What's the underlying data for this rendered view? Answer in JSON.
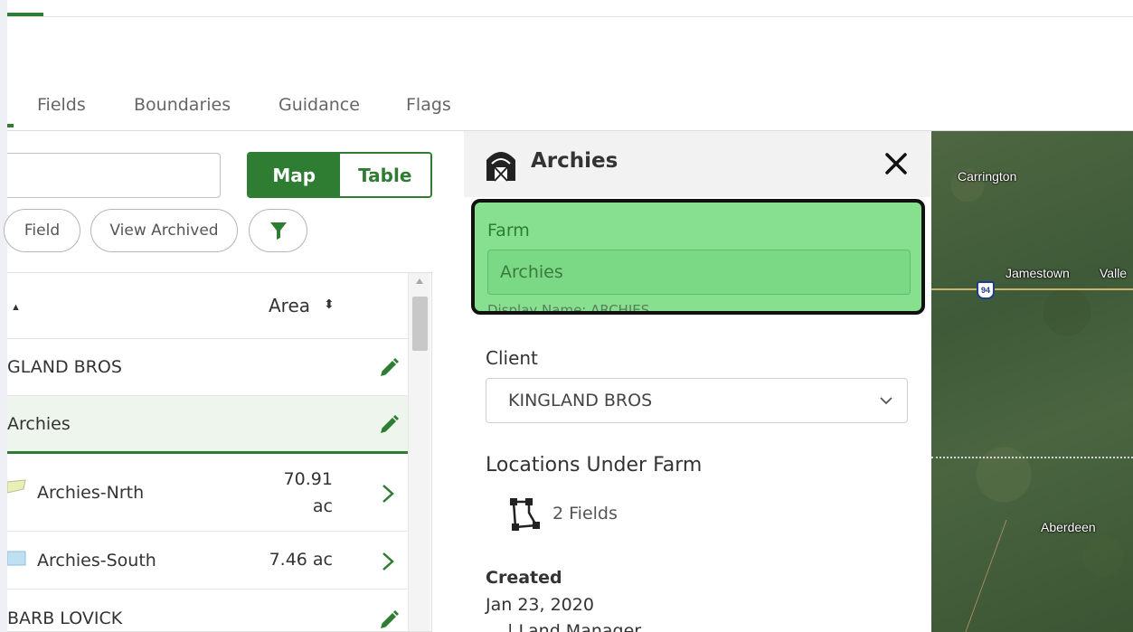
{
  "tabs": [
    {
      "label": "Fields"
    },
    {
      "label": "Boundaries"
    },
    {
      "label": "Guidance"
    },
    {
      "label": "Flags"
    }
  ],
  "toolbar": {
    "search_placeholder": "",
    "view_toggle": {
      "map": "Map",
      "table": "Table",
      "selected": "Map"
    },
    "add_field_label": "Field",
    "view_archived_label": "View Archived"
  },
  "table": {
    "sort_indicator": "▲",
    "area_header": "Area",
    "area_sort_indicator": "⬍",
    "rows": [
      {
        "name": "GLAND BROS",
        "type": "client",
        "area": ""
      },
      {
        "name": "Archies",
        "type": "farm",
        "area": "",
        "selected": true
      },
      {
        "name": "Archies-Nrth",
        "type": "field",
        "area": "70.91 ac",
        "swatch": "#e9efb9"
      },
      {
        "name": "Archies-South",
        "type": "field",
        "area": "7.46 ac",
        "swatch": "#bfe0f3"
      },
      {
        "name": "BARB LOVICK",
        "type": "client",
        "area": ""
      }
    ]
  },
  "detail": {
    "title": "Archies",
    "farm_label": "Farm",
    "farm_value": "Archies",
    "display_name": "Display Name: ARCHIES",
    "client_label": "Client",
    "client_value": "KINGLAND BROS",
    "locations_title": "Locations Under Farm",
    "fields_count": "2 Fields",
    "created_label": "Created",
    "created_date": "Jan 23, 2020",
    "created_by": "| Land Manager"
  },
  "map": {
    "labels": [
      "Carrington",
      "Jamestown",
      "Valle",
      "Aberdeen"
    ],
    "highway_shield": "94"
  },
  "colors": {
    "accent": "#2e7d32",
    "highlight": "#86e08f",
    "selected_row": "#eef5ec"
  }
}
